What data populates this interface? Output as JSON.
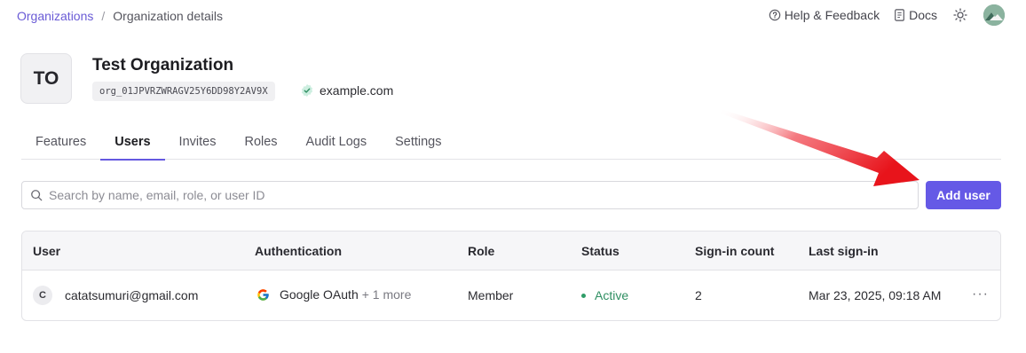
{
  "breadcrumb": {
    "root": "Organizations",
    "separator": "/",
    "current": "Organization details"
  },
  "top_actions": {
    "help": "Help & Feedback",
    "docs": "Docs"
  },
  "organization": {
    "initials": "TO",
    "name": "Test Organization",
    "id": "org_01JPVRZWRAGV25Y6DD98Y2AV9X",
    "domain": "example.com"
  },
  "tabs": [
    {
      "label": "Features",
      "active": false
    },
    {
      "label": "Users",
      "active": true
    },
    {
      "label": "Invites",
      "active": false
    },
    {
      "label": "Roles",
      "active": false
    },
    {
      "label": "Audit Logs",
      "active": false
    },
    {
      "label": "Settings",
      "active": false
    }
  ],
  "search": {
    "placeholder": "Search by name, email, role, or user ID",
    "value": ""
  },
  "add_user_label": "Add user",
  "table": {
    "columns": [
      "User",
      "Authentication",
      "Role",
      "Status",
      "Sign-in count",
      "Last sign-in"
    ],
    "rows": [
      {
        "initial": "C",
        "email": "catatsumuri@gmail.com",
        "auth": "Google OAuth",
        "auth_more": "+ 1 more",
        "role": "Member",
        "status": "Active",
        "sign_in_count": "2",
        "last_sign_in": "Mar 23, 2025, 09:18 AM",
        "menu": "···"
      }
    ]
  },
  "colors": {
    "accent": "#6559e6",
    "status_active": "#2f8f62",
    "arrow": "#e8141b"
  },
  "icons": [
    "help-circle-icon",
    "docs-icon",
    "sun-icon",
    "verified-check-icon",
    "search-icon",
    "google-icon"
  ]
}
